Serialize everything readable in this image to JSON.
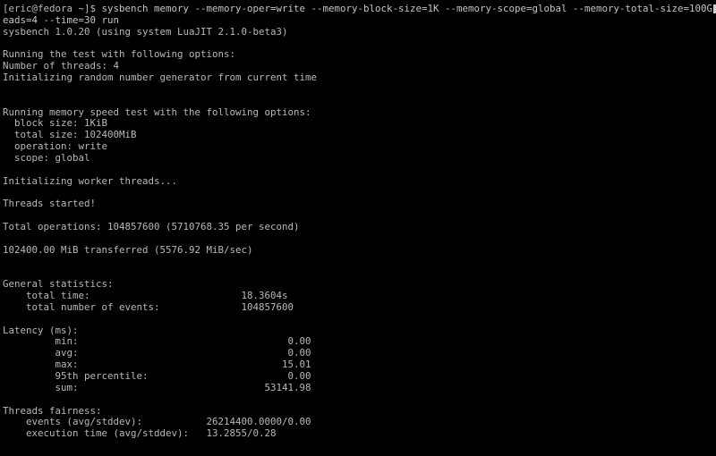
{
  "terminal": {
    "prompt": "[eric@fedora ~]$ ",
    "command_line_1": "sysbench memory --memory-oper=write --memory-block-size=1K --memory-scope=global --memory-total-size=100G --thr",
    "command_line_2": "eads=4 --time=30 run",
    "lines": [
      "sysbench 1.0.20 (using system LuaJIT 2.1.0-beta3)",
      "",
      "Running the test with following options:",
      "Number of threads: 4",
      "Initializing random number generator from current time",
      "",
      "",
      "Running memory speed test with the following options:",
      "  block size: 1KiB",
      "  total size: 102400MiB",
      "  operation: write",
      "  scope: global",
      "",
      "Initializing worker threads...",
      "",
      "Threads started!",
      "",
      "Total operations: 104857600 (5710768.35 per second)",
      "",
      "102400.00 MiB transferred (5576.92 MiB/sec)",
      "",
      "",
      "General statistics:",
      "    total time:                          18.3604s",
      "    total number of events:              104857600",
      "",
      "Latency (ms):",
      "         min:                                    0.00",
      "         avg:                                    0.00",
      "         max:                                   15.01",
      "         95th percentile:                        0.00",
      "         sum:                                53141.98",
      "",
      "Threads fairness:",
      "    events (avg/stddev):           26214400.0000/0.00",
      "    execution time (avg/stddev):   13.2855/0.28"
    ]
  }
}
